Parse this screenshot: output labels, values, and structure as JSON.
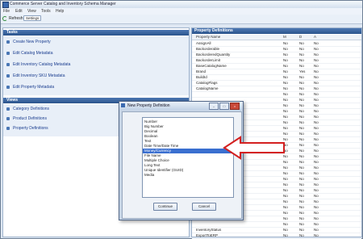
{
  "window": {
    "title": "Commerce Server Catalog and Inventory Schema Manager"
  },
  "menu": [
    "File",
    "Edit",
    "View",
    "Tools",
    "Help"
  ],
  "toolbar": {
    "refresh_label": "Refresh",
    "settings_label": "Settings"
  },
  "tasks": {
    "header": "Tasks",
    "items": [
      "Create New Property",
      "Edit Catalog Metadata",
      "Edit Inventory Catalog Metadata",
      "Edit Inventory SKU Metadata",
      "Edit Property Metadata"
    ]
  },
  "views": {
    "header": "Views",
    "items": [
      "Category Definitions",
      "Product Definitions",
      "Property Definitions"
    ]
  },
  "property_definitions": {
    "header": "Property Definitions",
    "columns": [
      "Property Name",
      "M",
      "D",
      "A"
    ],
    "rows": [
      [
        "AssignAll",
        "No",
        "No",
        "No"
      ],
      [
        "Backorderable",
        "No",
        "No",
        "No"
      ],
      [
        "BackorderedQuantity",
        "No",
        "No",
        "No"
      ],
      [
        "BackorderLimit",
        "No",
        "No",
        "No"
      ],
      [
        "BaseCatalogName",
        "No",
        "No",
        "No"
      ],
      [
        "Brand",
        "No",
        "Yes",
        "No"
      ],
      [
        "BuildId",
        "No",
        "No",
        "No"
      ],
      [
        "CatalogFlags",
        "No",
        "No",
        "No"
      ],
      [
        "CatalogName",
        "No",
        "No",
        "No"
      ],
      [
        "",
        "No",
        "No",
        "No"
      ],
      [
        "",
        "No",
        "No",
        "No"
      ],
      [
        "",
        "No",
        "No",
        "No"
      ],
      [
        "",
        "No",
        "No",
        "No"
      ],
      [
        "",
        "No",
        "No",
        "No"
      ],
      [
        "",
        "No",
        "No",
        "No"
      ],
      [
        "",
        "No",
        "No",
        "No"
      ],
      [
        "",
        "No",
        "No",
        "No"
      ],
      [
        "",
        "No",
        "No",
        "No"
      ],
      [
        "",
        "No",
        "No",
        "No"
      ],
      [
        "",
        "No",
        "No",
        "No"
      ],
      [
        "",
        "No",
        "No",
        "No"
      ],
      [
        "",
        "No",
        "No",
        "No"
      ],
      [
        "",
        "No",
        "No",
        "No"
      ],
      [
        "",
        "No",
        "No",
        "No"
      ],
      [
        "",
        "No",
        "No",
        "No"
      ],
      [
        "",
        "No",
        "No",
        "No"
      ],
      [
        "",
        "No",
        "No",
        "No"
      ],
      [
        "",
        "No",
        "No",
        "No"
      ],
      [
        "",
        "No",
        "No",
        "No"
      ],
      [
        "",
        "No",
        "No",
        "No"
      ],
      [
        "",
        "No",
        "No",
        "No"
      ],
      [
        "",
        "No",
        "No",
        "No"
      ],
      [
        "",
        "No",
        "No",
        "No"
      ],
      [
        "InventoryStatus",
        "No",
        "No",
        "No"
      ],
      [
        "ExportToERP",
        "No",
        "No",
        "No"
      ]
    ]
  },
  "dialog": {
    "title": "New Property Definition",
    "types": [
      "Number",
      "Big Number",
      "Decimal",
      "Boolean",
      "Text",
      "Date Time/Date Time",
      "Money/Currency",
      "File Name",
      "Multiple Choice",
      "Long Text",
      "Unique Identifier (GUID)",
      "Media"
    ],
    "selected_type": "Money/Currency",
    "ok_label": "Continue",
    "cancel_label": "Cancel"
  },
  "colors": {
    "accent": "#2b548c",
    "selection": "#3a6fd0",
    "arrow": "#d42020"
  }
}
